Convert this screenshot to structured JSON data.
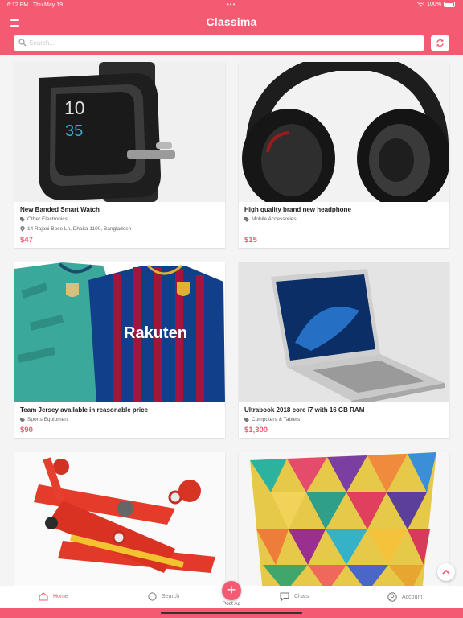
{
  "status_bar": {
    "time": "6:12 PM",
    "date": "Thu May 19",
    "battery": "100%"
  },
  "header": {
    "title": "Classima"
  },
  "search": {
    "placeholder": "Search..."
  },
  "listings": [
    {
      "title": "New Banded Smart Watch",
      "category": "Other Electronics",
      "location": "14 Rajani Bose Ln, Dhaka 1100, Bangladesh",
      "price": "$47"
    },
    {
      "title": "High quality brand new headphone",
      "category": "Mobile Accessories",
      "price": "$15"
    },
    {
      "title": "Team Jersey available in reasonable price",
      "category": "Sports Equipment",
      "price": "$90"
    },
    {
      "title": "Ultrabook 2018 core i7 with 16 GB RAM",
      "category": "Computers & Tablets",
      "price": "$1,300"
    }
  ],
  "images": {
    "watch_screen_time": "10",
    "watch_screen_minutes": "35",
    "jersey_sponsor": "Rakuten"
  },
  "tabs": {
    "home": "Home",
    "search": "Search",
    "post_ad": "Post Ad",
    "chats": "Chats",
    "account": "Account"
  },
  "colors": {
    "brand": "#f45b72",
    "price": "#f45b72",
    "background": "#f4f4f4"
  }
}
